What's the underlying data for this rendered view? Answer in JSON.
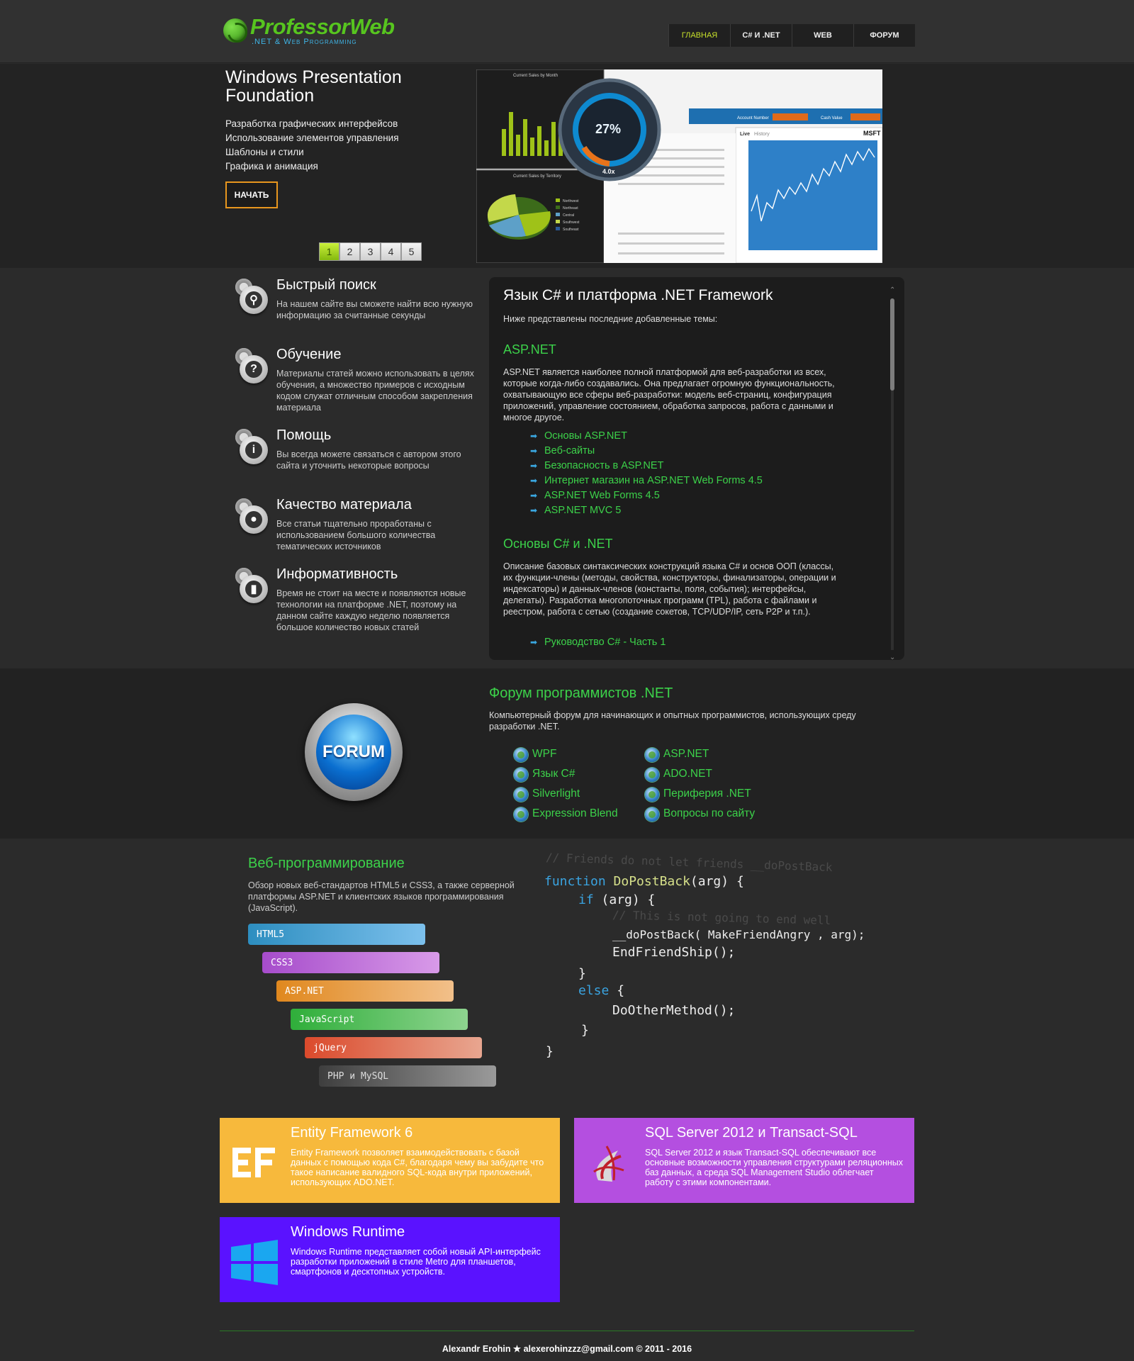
{
  "header": {
    "logo_name": "ProfessorWeb",
    "logo_tagline": ".NET & Web Programming",
    "nav": [
      {
        "label": "Главная",
        "active": true
      },
      {
        "label": "C# и .NET",
        "active": false
      },
      {
        "label": "WEB",
        "active": false
      },
      {
        "label": "Форум",
        "active": false
      }
    ]
  },
  "hero": {
    "title": "Windows Presentation Foundation",
    "items": [
      "Разработка графических интерфейсов",
      "Использование элементов управления",
      "Шаблоны и стили",
      "Графика и анимация"
    ],
    "start_label": "НАЧАТЬ",
    "pages": [
      "1",
      "2",
      "3",
      "4",
      "5"
    ],
    "active_page": "1",
    "screenshot": {
      "chart1_title": "Current Sales by Month",
      "chart2_title": "Current Sales by Territory",
      "gauge_value": "27%",
      "gauge_label": "4.0x",
      "account_label": "Account Number",
      "cash_label": "Cash Value",
      "ticker": "MSFT",
      "tab_live": "Live",
      "tab_history": "History",
      "territories": [
        "Northwest",
        "Northeast",
        "Central",
        "Southwest",
        "Southeast"
      ]
    }
  },
  "features": [
    {
      "title": "Быстрый поиск",
      "text": "На нашем сайте вы сможете найти всю нужную информацию за считанные секунды",
      "icon": "search-icon"
    },
    {
      "title": "Обучение",
      "text": "Материалы статей можно использовать в целях обучения, а множество примеров с исходным кодом служат отличным способом закрепления материала",
      "icon": "question-icon"
    },
    {
      "title": "Помощь",
      "text": "Вы всегда можете связаться с автором этого сайта и уточнить некоторые вопросы",
      "icon": "info-icon"
    },
    {
      "title": "Качество материала",
      "text": "Все статьи тщательно проработаны с использованием большого количества тематических источников",
      "icon": "lightbulb-icon"
    },
    {
      "title": "Информативность",
      "text": "Время не стоит на месте и появляются новые технологии на платформе .NET, поэтому на данном сайте каждую неделю появляется большое количество новых статей",
      "icon": "chart-icon"
    }
  ],
  "csharp": {
    "title": "Язык C# и платформа .NET Framework",
    "intro": "Ниже представлены последние добавленные темы:",
    "sections": [
      {
        "heading": "ASP.NET",
        "text": "ASP.NET является наиболее полной платформой для веб-разработки из всех, которые когда-либо создавались. Она предлагает огромную функциональность, охватывающую все сферы веб-разработки: модель веб-страниц, конфигурация приложений, управление состоянием, обработка запросов, работа с данными и многое другое.",
        "links": [
          "Основы ASP.NET",
          "Веб-сайты",
          "Безопасность в ASP.NET",
          "Интернет магазин на ASP.NET Web Forms 4.5",
          "ASP.NET Web Forms 4.5",
          "ASP.NET MVC 5"
        ]
      },
      {
        "heading": "Основы C# и .NET",
        "text": "Описание базовых синтаксических конструкций языка C# и основ ООП (классы, их функции-члены (методы, свойства, конструкторы, финализаторы, операции и индексаторы) и данных-членов (константы, поля, события); интерфейсы, делегаты). Разработка многопоточных программ (TPL), работа с файлами и реестром, работа с сетью (создание сокетов, TCP/UDP/IP, сеть P2P и т.п.).",
        "links": [
          "Руководство C# - Часть 1"
        ]
      }
    ]
  },
  "forum": {
    "button_label": "FORUM",
    "title": "Форум программистов .NET",
    "desc": "Компьютерный форум для начинающих и опытных программистов, использующих среду разработки .NET.",
    "links_left": [
      "WPF",
      "Язык C#",
      "Silverlight",
      "Expression Blend"
    ],
    "links_right": [
      "ASP.NET",
      "ADO.NET",
      "Периферия .NET",
      "Вопросы по сайту"
    ]
  },
  "web": {
    "title": "Веб-программирование",
    "desc": "Обзор новых веб-стандартов HTML5 и CSS3, а также серверной платформы ASP.NET и клиентских языков программирования (JavaScript).",
    "bars": [
      {
        "label": "HTML5",
        "color": "#3a9fd0"
      },
      {
        "label": "CSS3",
        "color": "#b456d6"
      },
      {
        "label": "ASP.NET",
        "color": "#e8962a"
      },
      {
        "label": "JavaScript",
        "color": "#3fb84a"
      },
      {
        "label": "jQuery",
        "color": "#e0523a"
      },
      {
        "label": "PHP и MySQL",
        "color": "#555555"
      }
    ],
    "code": {
      "c1": "// Friends do not let friends __doPostBack",
      "l1a": "function ",
      "l1b": "DoPostBack",
      "l1c": "(arg) {",
      "l2a": "if",
      "l2b": " (arg) {",
      "c2": "// This is not going to end well",
      "l3": "__doPostBack( MakeFriendAngry , arg);",
      "l4": "EndFriendShip();",
      "l5": "}",
      "l6a": "else",
      "l6b": " {",
      "l7": "DoOtherMethod();",
      "l8": "}",
      "l9": "}"
    }
  },
  "tiles": [
    {
      "title": "Entity Framework 6",
      "text": "Entity Framework позволяет взаимодействовать с базой данных с помощью кода C#, благодаря чему вы забудите что такое написание валидного SQL-кода внутри приложений, использующих ADO.NET.",
      "color": "#f7b93c",
      "icon": "ef-logo-icon"
    },
    {
      "title": "SQL Server 2012 и Transact-SQL",
      "text": "SQL Server 2012 и язык Transact-SQL обеспечивают все основные возможности управления структурами реляционных баз данных, а среда SQL Management Studio облегчает работу с этими компонентами.",
      "color": "#b44fe0",
      "icon": "sql-server-icon"
    },
    {
      "title": "Windows Runtime",
      "text": "Windows Runtime представляет собой новый API-интерфейс разработки приложений в стиле Metro для планшетов, смартфонов и десктопных устройств.",
      "color": "#5a12ff",
      "icon": "windows-logo-icon"
    }
  ],
  "footer": {
    "text": "Alexandr Erohin ★ alexerohinzzz@gmail.com © 2011 - 2016"
  }
}
